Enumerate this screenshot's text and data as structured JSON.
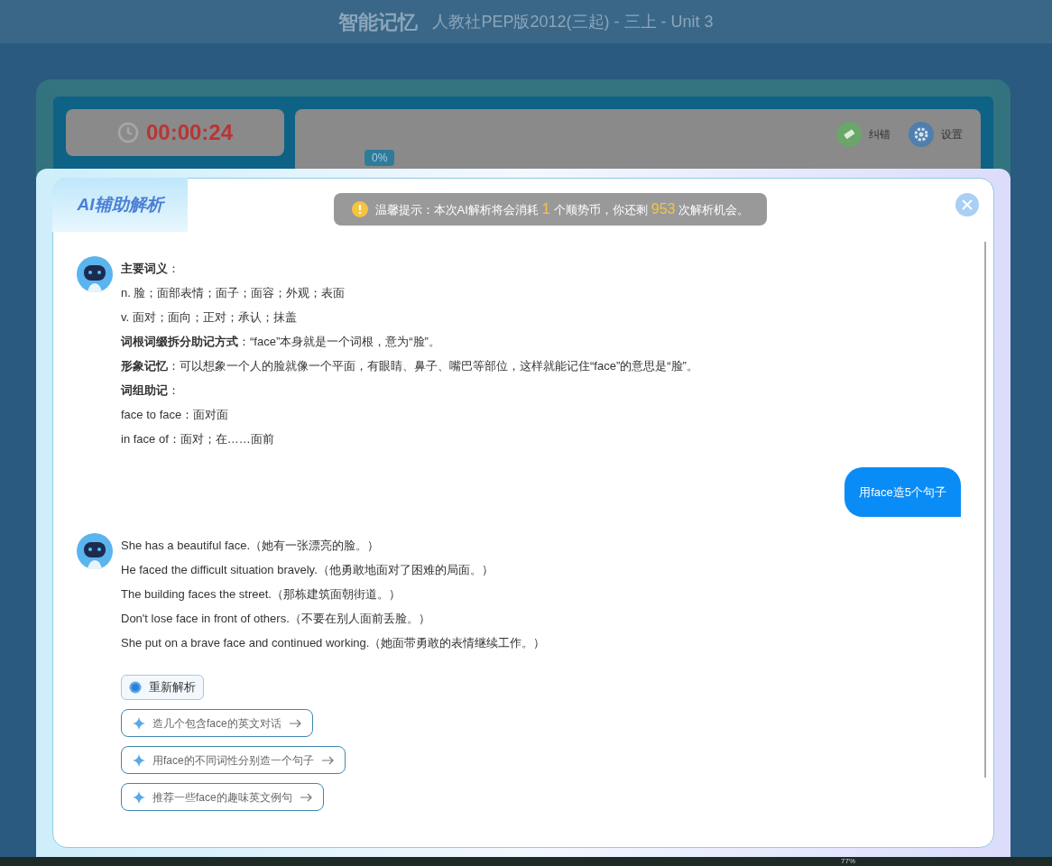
{
  "header": {
    "title": "智能记忆",
    "subtitle": "人教社PEP版2012(三起) - 三上 - Unit 3"
  },
  "timer": "00:00:24",
  "progress": {
    "label": "0%"
  },
  "toolbar": [
    {
      "kind": "correct",
      "label": "纠错"
    },
    {
      "kind": "settings",
      "label": "设置"
    }
  ],
  "dialog": {
    "title": "AI辅助解析",
    "notice": {
      "before": "温馨提示：本次AI解析将会消耗",
      "cost": "1",
      "middle": "个顺势币，你还剩",
      "remaining": "953",
      "after": "次解析机会。"
    },
    "messages": [
      {
        "kind": "ai",
        "lines": [
          "**主要词义**：",
          "n. 脸；面部表情；面子；面容；外观；表面",
          "v. 面对；面向；正对；承认；抹盖",
          "**词根词缀拆分助记方式**：“face”本身就是一个词根，意为“脸”。",
          "**形象记忆**：可以想象一个人的脸就像一个平面，有眼睛、鼻子、嘴巴等部位，这样就能记住“face”的意思是“脸”。",
          "**词组助记**：",
          "face to face：面对面",
          "in face of：面对；在……面前"
        ]
      },
      {
        "kind": "user",
        "text": "用face造5个句子"
      },
      {
        "kind": "ai",
        "lines": [
          "She has a beautiful face.（她有一张漂亮的脸。）",
          "He faced the difficult situation bravely.（他勇敢地面对了困难的局面。）",
          "The building faces the street.（那栋建筑面朝街道。）",
          "Don't lose face in front of others.（不要在别人面前丢脸。）",
          "She put on a brave face and continued working.（她面带勇敢的表情继续工作。）"
        ]
      }
    ],
    "actions": [
      {
        "kind": "regenerate",
        "label": "重新解析"
      },
      {
        "kind": "suggestion",
        "label": "造几个包含face的英文对话"
      },
      {
        "kind": "suggestion",
        "label": "用face的不同词性分别造一个句子"
      },
      {
        "kind": "suggestion",
        "label": "推荐一些face的趣味英文例句"
      }
    ]
  },
  "taskbar": {
    "battery": "77%"
  }
}
